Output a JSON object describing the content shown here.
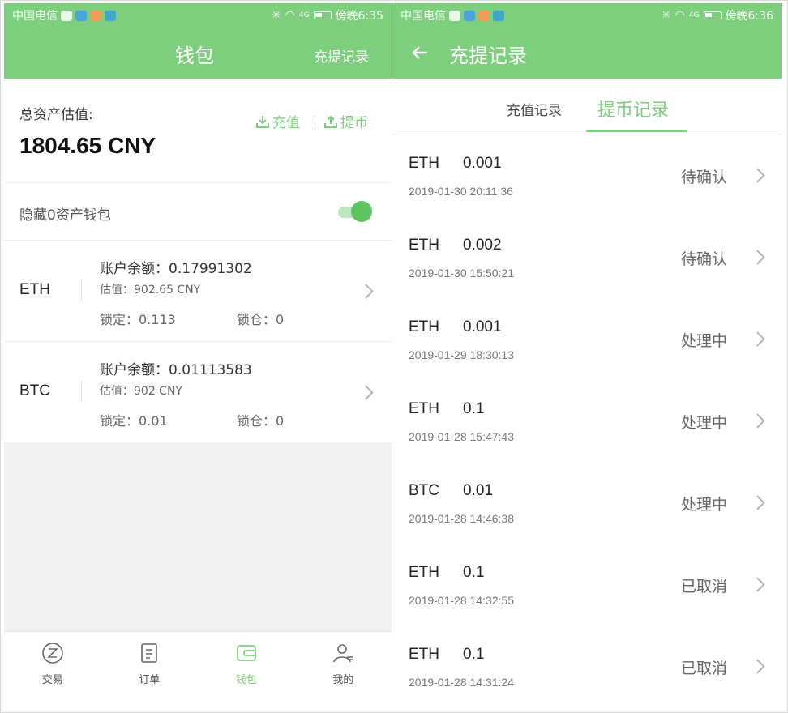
{
  "left": {
    "status": {
      "carrier": "中国电信",
      "time": "傍晚6:35",
      "signal": "4G"
    },
    "nav": {
      "title": "钱包",
      "records_link": "充提记录"
    },
    "summary": {
      "total_label": "总资产估值:",
      "total_value": "1804.65 CNY",
      "deposit_label": "充值",
      "withdraw_label": "提币"
    },
    "hide_zero": {
      "label": "隐藏0资产钱包",
      "enabled": true
    },
    "coins": [
      {
        "symbol": "ETH",
        "balance": "账户余额：0.17991302",
        "estimate": "估值：902.65 CNY",
        "locked": "锁定：0.113",
        "lock_position": "锁仓：0"
      },
      {
        "symbol": "BTC",
        "balance": "账户余额：0.01113583",
        "estimate": "估值：902 CNY",
        "locked": "锁定：0.01",
        "lock_position": "锁仓：0"
      }
    ],
    "tabs": [
      {
        "label": "交易",
        "icon": "exchange-icon"
      },
      {
        "label": "订单",
        "icon": "order-icon"
      },
      {
        "label": "钱包",
        "icon": "wallet-icon",
        "active": true
      },
      {
        "label": "我的",
        "icon": "profile-icon"
      }
    ]
  },
  "right": {
    "status": {
      "carrier": "中国电信",
      "time": "傍晚6:36",
      "signal": "4G"
    },
    "nav": {
      "title": "充提记录",
      "back_icon": "arrow-left-icon"
    },
    "tabs": {
      "deposit": "充值记录",
      "withdraw": "提币记录",
      "active": "withdraw"
    },
    "records": [
      {
        "coin": "ETH",
        "amount": "0.001",
        "time": "2019-01-30  20:11:36",
        "status": "待确认"
      },
      {
        "coin": "ETH",
        "amount": "0.002",
        "time": "2019-01-30  15:50:21",
        "status": "待确认"
      },
      {
        "coin": "ETH",
        "amount": "0.001",
        "time": "2019-01-29  18:30:13",
        "status": "处理中"
      },
      {
        "coin": "ETH",
        "amount": "0.1",
        "time": "2019-01-28  15:47:43",
        "status": "处理中"
      },
      {
        "coin": "BTC",
        "amount": "0.01",
        "time": "2019-01-28  14:46:38",
        "status": "处理中"
      },
      {
        "coin": "ETH",
        "amount": "0.1",
        "time": "2019-01-28  14:32:55",
        "status": "已取消"
      },
      {
        "coin": "ETH",
        "amount": "0.1",
        "time": "2019-01-28  14:31:24",
        "status": "已取消"
      }
    ]
  },
  "colors": {
    "accent": "#7dcf7e",
    "background": "#f2f2f2",
    "text": "#222222"
  }
}
